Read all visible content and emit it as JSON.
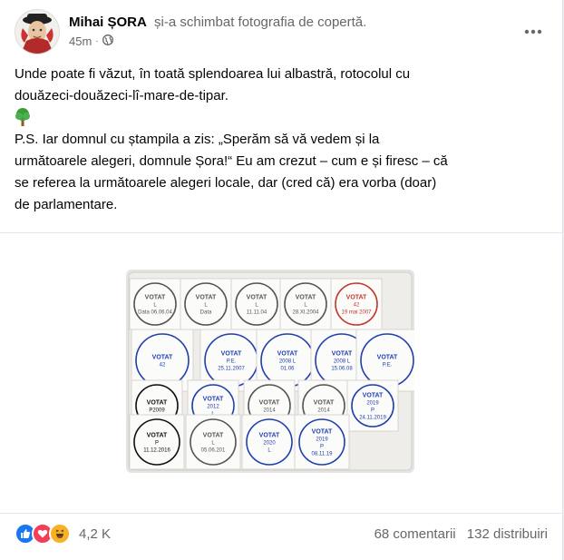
{
  "post": {
    "author": "Mihai ȘORA",
    "action": "și-a schimbat fotografia de copertă.",
    "time": "45m",
    "dot": "·",
    "privacy_icon": "globe-icon",
    "more_icon": "more-options-icon",
    "text_lines": [
      "Unde poate fi văzut, în toată splendoarea lui albastră, rotocolul cu",
      "douăzeci-douăzeci-lî-mare-de-tipar."
    ],
    "emoji": "deciduous-tree-emoji",
    "ps_lines": [
      "P.S. Iar domnul cu ștampila a zis: „Sperăm să vă vedem și la",
      "următoarele alegeri, domnule Șora!“ Eu am crezut – cum e și firesc – că",
      "se referea la următoarele alegeri locale, dar (cred că) era vorba (doar)",
      "de parlamentare."
    ]
  },
  "photo": {
    "stamps": [
      {
        "lines": [
          "VOTAT",
          "L",
          "Data 06.06.04"
        ],
        "color": "#555555"
      },
      {
        "lines": [
          "VOTAT",
          "L",
          "Data"
        ],
        "color": "#555555"
      },
      {
        "lines": [
          "VOTAT",
          "L",
          "11.11.04"
        ],
        "color": "#555555"
      },
      {
        "lines": [
          "VOTAT",
          "L",
          "28.XI.2004"
        ],
        "color": "#555555"
      },
      {
        "lines": [
          "VOTAT",
          "42",
          "19 mai 2007"
        ],
        "color": "#c0392b"
      },
      {
        "lines": [
          "VOTAT",
          "42"
        ],
        "color": "#1f3fae"
      },
      {
        "lines": [
          "VOTAT",
          "P.E.",
          "25.11.2007"
        ],
        "color": "#1f3fae"
      },
      {
        "lines": [
          "VOTAT",
          "2008 L",
          "01.06"
        ],
        "color": "#1f3fae"
      },
      {
        "lines": [
          "VOTAT",
          "2008 L",
          "15.06.08"
        ],
        "color": "#1f3fae"
      },
      {
        "lines": [
          "VOTAT",
          "P.E."
        ],
        "color": "#1f3fae"
      },
      {
        "lines": [
          "VOTAT",
          "P2009"
        ],
        "color": "#111111"
      },
      {
        "lines": [
          "VOTAT",
          "2012",
          "L"
        ],
        "color": "#1f3fae"
      },
      {
        "lines": [
          "VOTAT",
          "2014"
        ],
        "color": "#555555"
      },
      {
        "lines": [
          "VOTAT",
          "2014"
        ],
        "color": "#555555"
      },
      {
        "lines": [
          "VOTAT",
          "2019",
          "P",
          "24.11.2019"
        ],
        "color": "#1f3fae"
      },
      {
        "lines": [
          "VOTAT",
          "P",
          "11.12.2016"
        ],
        "color": "#111111"
      },
      {
        "lines": [
          "VOTAT",
          "L",
          "05.06.201"
        ],
        "color": "#555555"
      },
      {
        "lines": [
          "VOTAT",
          "2020",
          "L"
        ],
        "color": "#1f3fae"
      },
      {
        "lines": [
          "VOTAT",
          "2019",
          "P",
          "08.11.19"
        ],
        "color": "#1f3fae"
      }
    ]
  },
  "footer": {
    "reaction_icons": [
      "like-icon",
      "love-icon",
      "haha-icon"
    ],
    "reaction_count": "4,2 K",
    "comments": "68 comentarii",
    "shares": "132 distribuiri"
  },
  "colors": {
    "like": "#1877f2",
    "love": "#f33e58",
    "haha": "#f7b125",
    "secondary_text": "#65676b",
    "stamp_blue": "#1f3fae"
  }
}
